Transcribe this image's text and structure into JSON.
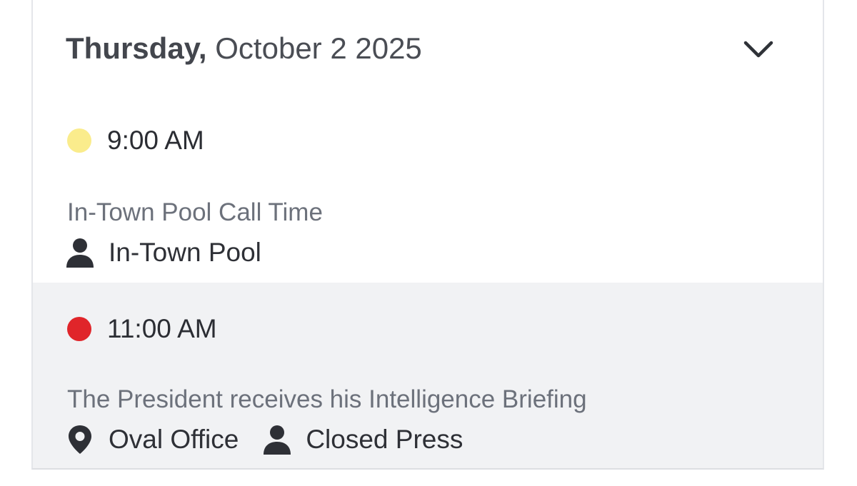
{
  "schedule": {
    "day": {
      "weekday": "Thursday,",
      "date": "October 2 2025",
      "toggle_icon": "chevron-down-icon"
    },
    "events": [
      {
        "time": "9:00 AM",
        "status_color": "#faec8c",
        "title": "In-Town Pool Call Time",
        "coverage_icon": "person-icon",
        "coverage": "In-Town Pool"
      },
      {
        "time": "11:00 AM",
        "status_color": "#e0252a",
        "title": "The President receives his Intelligence Briefing",
        "location_icon": "map-pin-icon",
        "location": "Oval Office",
        "coverage_icon": "person-icon",
        "coverage": "Closed Press"
      }
    ]
  },
  "colors": {
    "text_dark": "#2e3036",
    "text_muted": "#6c717b",
    "alt_row_bg": "#f1f2f4"
  }
}
